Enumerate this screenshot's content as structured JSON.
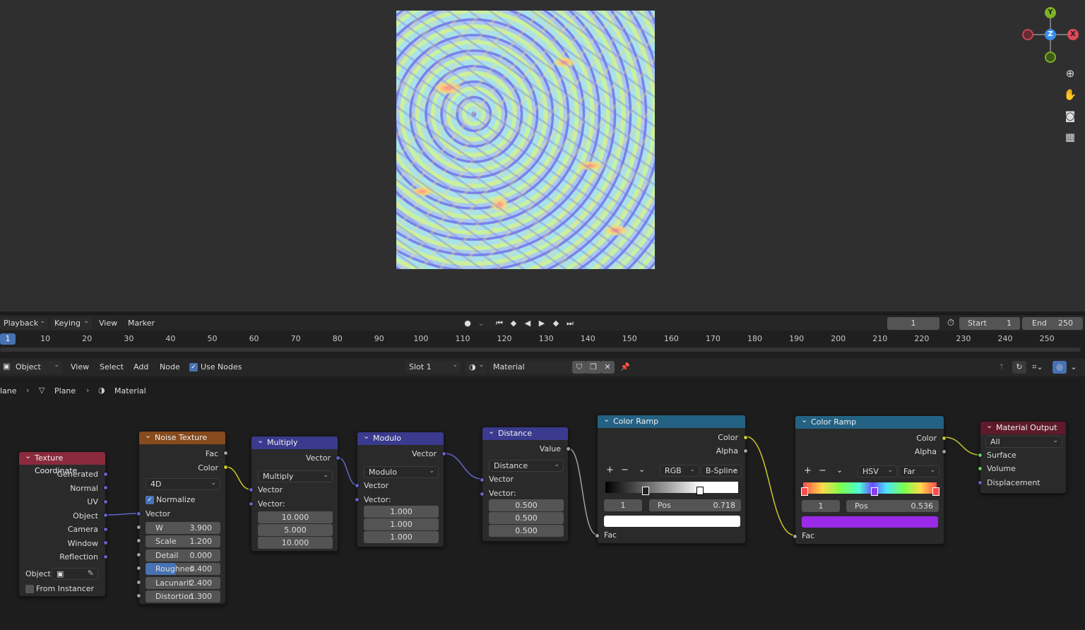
{
  "timeline": {
    "playback": "Playback",
    "keying": "Keying",
    "view": "View",
    "marker": "Marker",
    "current_frame": "1",
    "start_label": "Start",
    "start_value": "1",
    "end_label": "End",
    "end_value": "250",
    "ticks": [
      "1",
      "10",
      "20",
      "30",
      "40",
      "50",
      "60",
      "70",
      "80",
      "90",
      "100",
      "110",
      "120",
      "130",
      "140",
      "150",
      "160",
      "170",
      "180",
      "190",
      "200",
      "210",
      "220",
      "230",
      "240",
      "250"
    ]
  },
  "node_header": {
    "mode": "Object",
    "view": "View",
    "select": "Select",
    "add": "Add",
    "node": "Node",
    "use_nodes": "Use Nodes",
    "slot": "Slot 1",
    "material": "Material"
  },
  "breadcrumb": {
    "object": "lane",
    "mesh": "Plane",
    "material": "Material"
  },
  "gizmo": {
    "x": "X",
    "y": "Y",
    "z": "Z"
  },
  "nodes": {
    "tex_coord": {
      "title": "Texture Coordinate",
      "outputs": [
        "Generated",
        "Normal",
        "UV",
        "Object",
        "Camera",
        "Window",
        "Reflection"
      ],
      "object_label": "Object:",
      "from_instancer": "From Instancer"
    },
    "noise": {
      "title": "Noise Texture",
      "out_fac": "Fac",
      "out_color": "Color",
      "dimensions": "4D",
      "normalize": "Normalize",
      "vector": "Vector",
      "fields": [
        {
          "label": "W",
          "value": "3.900"
        },
        {
          "label": "Scale",
          "value": "1.200"
        },
        {
          "label": "Detail",
          "value": "0.000"
        },
        {
          "label": "Roughnes",
          "value": "0.400"
        },
        {
          "label": "Lacunarit",
          "value": "2.400"
        },
        {
          "label": "Distortion",
          "value": "1.300"
        }
      ]
    },
    "multiply": {
      "title": "Multiply",
      "out": "Vector",
      "op": "Multiply",
      "in1": "Vector",
      "in2": "Vector:",
      "values": [
        "10.000",
        "5.000",
        "10.000"
      ]
    },
    "modulo": {
      "title": "Modulo",
      "out": "Vector",
      "op": "Modulo",
      "in1": "Vector",
      "in2": "Vector:",
      "values": [
        "1.000",
        "1.000",
        "1.000"
      ]
    },
    "distance": {
      "title": "Distance",
      "out": "Value",
      "op": "Distance",
      "in1": "Vector",
      "in2": "Vector:",
      "values": [
        "0.500",
        "0.500",
        "0.500"
      ]
    },
    "ramp1": {
      "title": "Color Ramp",
      "out_color": "Color",
      "out_alpha": "Alpha",
      "mode": "RGB",
      "interp": "B-Spline",
      "index": "1",
      "pos_label": "Pos",
      "pos_value": "0.718",
      "in_fac": "Fac",
      "swatch": "#ffffff"
    },
    "ramp2": {
      "title": "Color Ramp",
      "out_color": "Color",
      "out_alpha": "Alpha",
      "mode": "HSV",
      "interp": "Far",
      "index": "1",
      "pos_label": "Pos",
      "pos_value": "0.536",
      "in_fac": "Fac",
      "swatch": "#9a2ae8"
    },
    "output": {
      "title": "Material Output",
      "target": "All",
      "inputs": [
        "Surface",
        "Volume",
        "Displacement"
      ]
    }
  },
  "colors": {
    "accent": "#4772b3",
    "input_header": "#8a2a3c",
    "texture_header": "#864a1c",
    "vector_header": "#3a3a8e",
    "converter_header": "#246283",
    "output_header": "#5e1a2a"
  }
}
